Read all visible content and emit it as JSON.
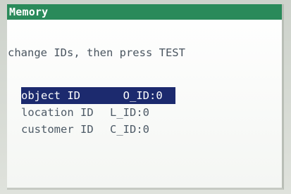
{
  "window": {
    "title": "Memory"
  },
  "instruction": "change IDs, then press TEST",
  "ids": [
    {
      "label": "object ID",
      "value": "  O_ID:0",
      "selected": true
    },
    {
      "label": "location ID",
      "value": "L_ID:0",
      "selected": false
    },
    {
      "label": "customer ID",
      "value": "C_ID:0",
      "selected": false
    }
  ],
  "colors": {
    "titlebar": "#2a8a5a",
    "selection": "#1c2a6e",
    "text": "#4d5a66"
  }
}
